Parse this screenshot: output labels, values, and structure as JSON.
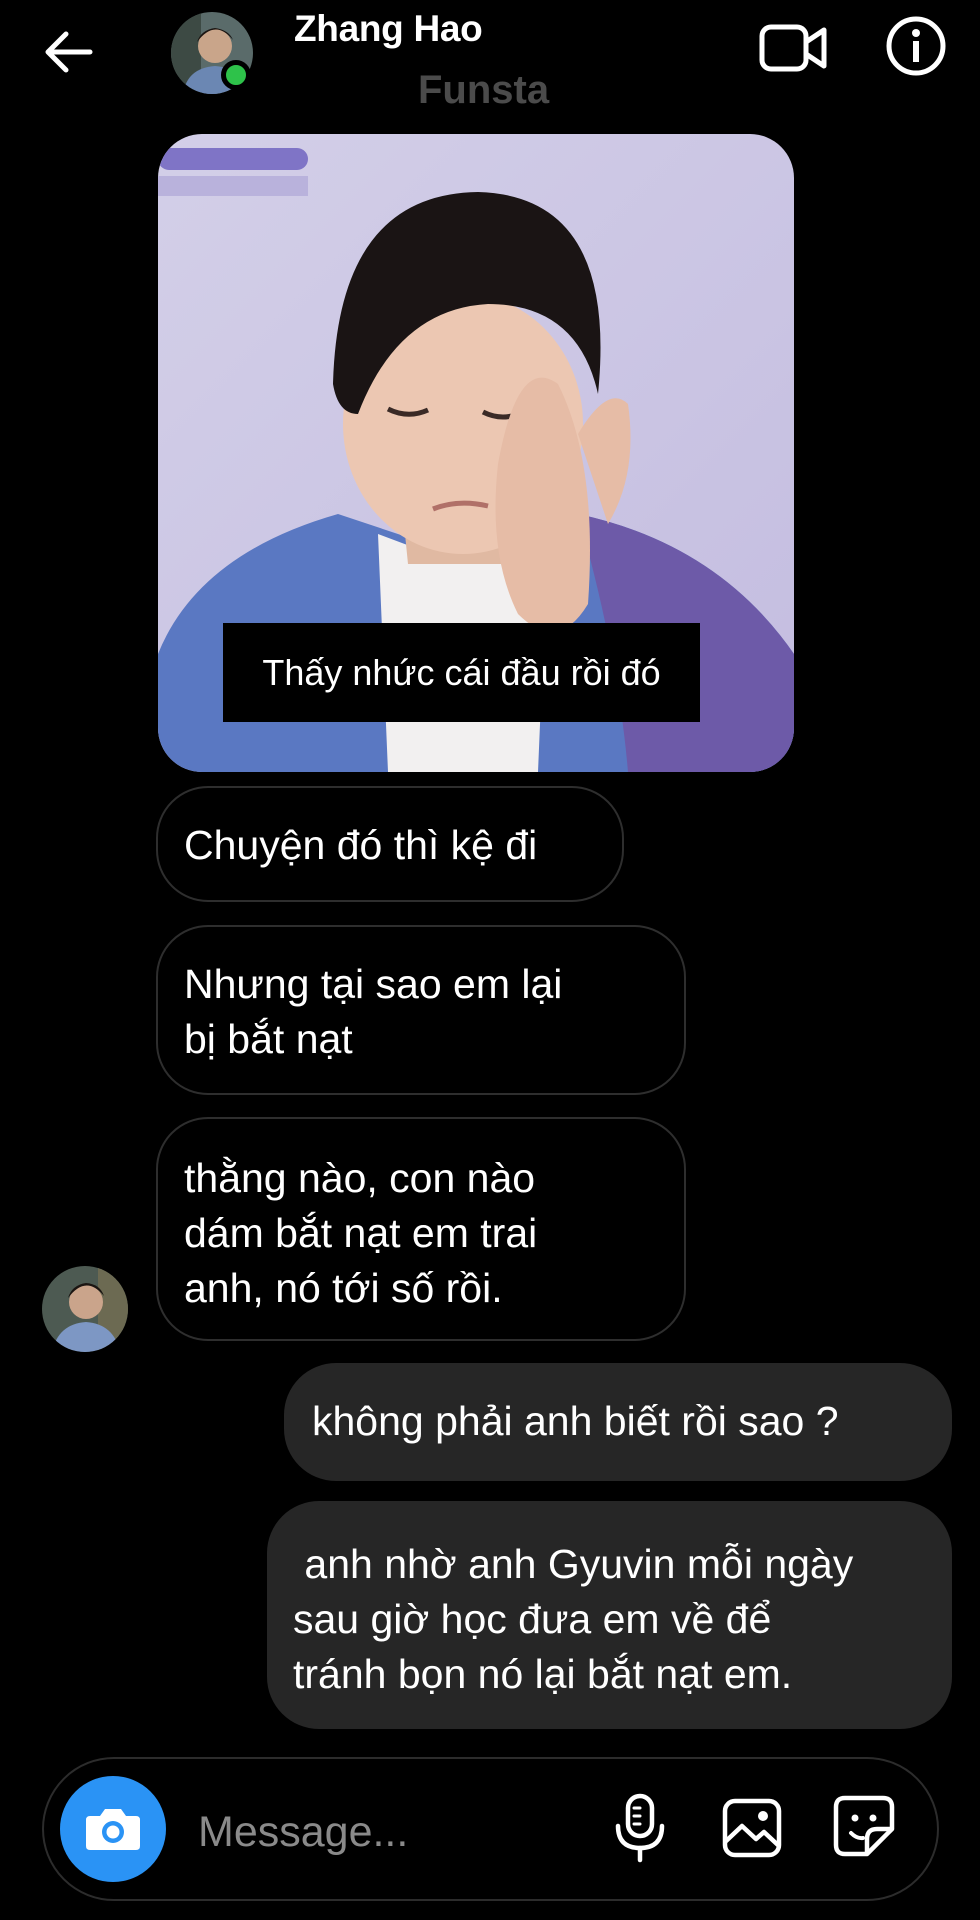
{
  "header": {
    "name": "Zhang Hao",
    "subtitle": "Funsta",
    "icons": {
      "back": "back-arrow-icon",
      "video": "video-call-icon",
      "info": "info-icon"
    },
    "online_color": "#2ec24a"
  },
  "messages": [
    {
      "direction": "incoming",
      "type": "image",
      "caption": "Thấy nhức cái đầu rồi đó"
    },
    {
      "direction": "incoming",
      "type": "text",
      "text": "Chuyện đó thì kệ đi"
    },
    {
      "direction": "incoming",
      "type": "text",
      "text": "Nhưng tại sao em lại\nbị bắt nạt"
    },
    {
      "direction": "incoming",
      "type": "text",
      "text": "thằng nào, con nào\ndám bắt nạt em trai\nanh, nó tới số rồi."
    },
    {
      "direction": "outgoing",
      "type": "text",
      "text": "không phải anh biết rồi sao ?"
    },
    {
      "direction": "outgoing",
      "type": "text",
      "text": " anh nhờ anh Gyuvin mỗi ngày\nsau giờ học đưa em về để\ntránh bọn nó lại bắt nạt em."
    }
  ],
  "composer": {
    "placeholder": "Message...",
    "icons": {
      "camera": "camera-icon",
      "mic": "microphone-icon",
      "gallery": "gallery-icon",
      "sticker": "sticker-icon"
    },
    "accent": "#2a93f5"
  },
  "colors": {
    "background": "#000000",
    "outgoing_bubble": "#262626",
    "incoming_border": "#2e2e2e"
  }
}
